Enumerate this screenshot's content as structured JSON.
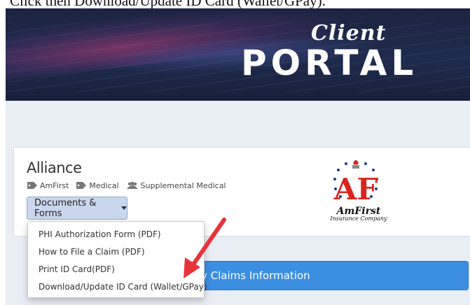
{
  "caption": "Click then Download/Update ID Card (Wallet/GPay).",
  "banner": {
    "logo_script": "Client",
    "logo_main": "PORTAL"
  },
  "card": {
    "plan_name": "Alliance",
    "tags": [
      {
        "icon": "tag-icon",
        "label": "AmFirst"
      },
      {
        "icon": "tag-icon",
        "label": "Medical"
      },
      {
        "icon": "users-icon",
        "label": "Supplemental Medical"
      }
    ],
    "docs_button_label": "Documents & Forms",
    "insurer_logo": {
      "name": "AmFirst",
      "subtitle": "Insurance Company",
      "monogram": "AF"
    }
  },
  "dropdown": {
    "items": [
      "PHI Authorization Form (PDF)",
      "How to File a Claim (PDF)",
      "Print ID Card(PDF)",
      "Download/Update ID Card (Wallet/GPay)"
    ]
  },
  "claims_button_label": "v Claims Information",
  "colors": {
    "banner": "#1f2b4d",
    "page_bg": "#e9edf4",
    "docs_button": "#c9d7ec",
    "claims_button": "#3b8ee0",
    "arrow": "#e8333a",
    "logo_red": "#d7261e",
    "logo_stars": "#1a3d8f"
  }
}
